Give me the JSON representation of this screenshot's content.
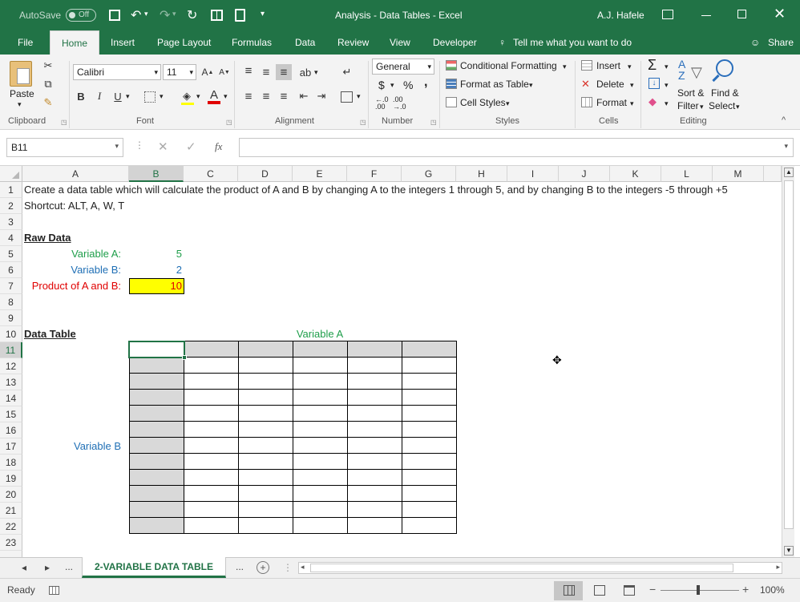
{
  "title_bar": {
    "autosave_label": "AutoSave",
    "autosave_state": "Off",
    "window_title": "Analysis - Data Tables  -  Excel",
    "user_name": "A.J. Hafele"
  },
  "ribbon_tabs": [
    "File",
    "Home",
    "Insert",
    "Page Layout",
    "Formulas",
    "Data",
    "Review",
    "View",
    "Developer"
  ],
  "tell_me": "Tell me what you want to do",
  "share_label": "Share",
  "ribbon": {
    "clipboard": {
      "paste_label": "Paste",
      "group": "Clipboard"
    },
    "font": {
      "name": "Calibri",
      "size": "11",
      "group": "Font"
    },
    "alignment": {
      "group": "Alignment"
    },
    "number": {
      "format": "General",
      "currency": "$",
      "percent": "%",
      "comma": ",",
      "group": "Number"
    },
    "styles": {
      "conditional_formatting": "Conditional Formatting",
      "format_as_table": "Format as Table",
      "cell_styles": "Cell Styles",
      "group": "Styles"
    },
    "cells": {
      "insert": "Insert",
      "delete": "Delete",
      "format": "Format",
      "group": "Cells"
    },
    "editing": {
      "sort_filter_1": "Sort &",
      "sort_filter_2": "Filter",
      "find_select_1": "Find &",
      "find_select_2": "Select",
      "group": "Editing"
    }
  },
  "formula_bar": {
    "name_box": "B11",
    "formula": ""
  },
  "columns": [
    "A",
    "B",
    "C",
    "D",
    "E",
    "F",
    "G",
    "H",
    "I",
    "J",
    "K",
    "L",
    "M"
  ],
  "rows": [
    "1",
    "2",
    "3",
    "4",
    "5",
    "6",
    "7",
    "8",
    "9",
    "10",
    "11",
    "12",
    "13",
    "14",
    "15",
    "16",
    "17",
    "18",
    "19",
    "20",
    "21",
    "22",
    "23"
  ],
  "cells": {
    "a1": "Create a data table which will calculate the product of A and B by changing A to the integers 1 through 5, and by changing B to the integers -5 through +5",
    "a2": "Shortcut: ALT, A, W, T",
    "a4": "Raw Data",
    "a5": "Variable A:",
    "b5": "5",
    "a6": "Variable B:",
    "b6": "2",
    "a7": "Product of A and B:",
    "b7": "10",
    "a10": "Data Table",
    "e10": "Variable A",
    "a17": "Variable B"
  },
  "colors": {
    "excel_green": "#217346",
    "variable_a": "#1e9e4a",
    "variable_b": "#1f6fb5",
    "product": "#e00000",
    "highlight": "#ffff00",
    "table_shade": "#d9d9d9"
  },
  "sheet_tab": {
    "active": "2-VARIABLE DATA TABLE",
    "ellipsis": "..."
  },
  "status_bar": {
    "status": "Ready",
    "zoom": "100%"
  }
}
